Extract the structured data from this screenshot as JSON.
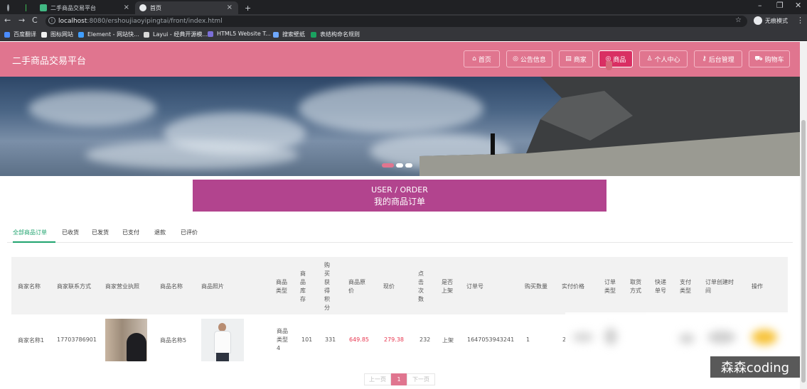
{
  "browser": {
    "tabs": [
      {
        "label": "二手商品交易平台",
        "active": false
      },
      {
        "label": "首页",
        "active": true
      }
    ],
    "new_tab": "+",
    "url_host": "localhost",
    "url_rest": ":8080/ershoujiaoyipingtai/front/index.html",
    "incognito_label": "无痕模式",
    "bookmarks": [
      "百度翻译",
      "图标网站",
      "Element - 网站快...",
      "Layui - 经典开源模...",
      "HTML5 Website T...",
      "搜索壁纸",
      "表结构命名规则"
    ]
  },
  "site": {
    "brand": "二手商品交易平台",
    "nav": [
      {
        "label": "首页",
        "icon": "home-icon"
      },
      {
        "label": "公告信息",
        "icon": "notice-icon"
      },
      {
        "label": "商家",
        "icon": "shop-icon"
      },
      {
        "label": "商品",
        "icon": "goods-icon"
      },
      {
        "label": "个人中心",
        "icon": "user-icon"
      },
      {
        "label": "后台管理",
        "icon": "wrench-icon"
      },
      {
        "label": "购物车",
        "icon": "cart-icon"
      }
    ],
    "active_nav": "商品"
  },
  "page": {
    "title_en": "USER / ORDER",
    "title_cn": "我的商品订单",
    "order_tabs": [
      "全部商品订单",
      "已收货",
      "已发货",
      "已支付",
      "退款",
      "已评价"
    ],
    "active_tab": "全部商品订单"
  },
  "table": {
    "headers": [
      "商家名称",
      "商家联系方式",
      "商家营业执照",
      "商品名称",
      "商品照片",
      "商品类型",
      "商品库存",
      "购买获得积分",
      "商品原价",
      "现价",
      "点击次数",
      "是否上架",
      "订单号",
      "购买数量",
      "实付价格",
      "订单类型",
      "取货方式",
      "快递单号",
      "支付类型",
      "订单创建时间",
      "操作"
    ],
    "rows": [
      {
        "merchant_name": "商家名称1",
        "merchant_phone": "17703786901",
        "product_name": "商品名称5",
        "product_type": "商品类型4",
        "stock": "101",
        "points": "331",
        "original_price": "649.85",
        "price": "279.38",
        "clicks": "232",
        "listed": "上架",
        "order_no": "1647053943241",
        "quantity": "1",
        "paid_partial": "2"
      }
    ]
  },
  "pagination": {
    "prev": "上一页",
    "current": "1",
    "next": "下一页"
  },
  "watermark": "森森coding",
  "colors": {
    "header": "#e0758f",
    "title_box": "#b2448e",
    "active_tab": "#1fa36e",
    "price": "#e8364f"
  }
}
